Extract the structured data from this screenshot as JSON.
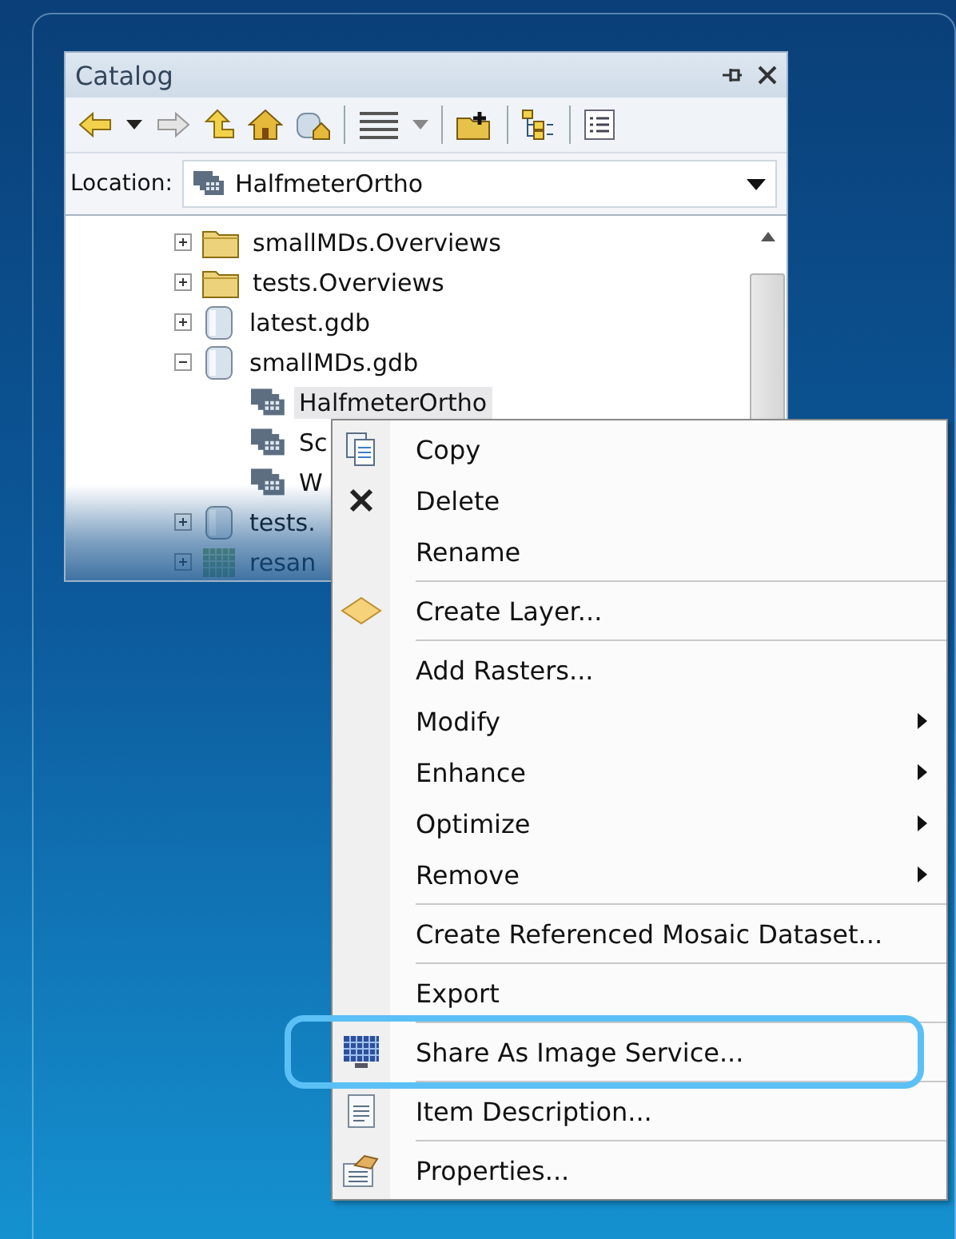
{
  "catalog": {
    "title": "Catalog",
    "location_label": "Location:",
    "location_value": "HalfmeterOrtho",
    "tree": [
      {
        "kind": "folder",
        "label": "smallMDs.Overviews",
        "expanded": false,
        "selected": false
      },
      {
        "kind": "folder",
        "label": "tests.Overviews",
        "expanded": false,
        "selected": false
      },
      {
        "kind": "gdb",
        "label": "latest.gdb",
        "expanded": false,
        "selected": false
      },
      {
        "kind": "gdb",
        "label": "smallMDs.gdb",
        "expanded": true,
        "selected": false,
        "children": [
          {
            "kind": "mosaic",
            "label": "HalfmeterOrtho",
            "selected": true
          },
          {
            "kind": "mosaic",
            "label": "Sc",
            "selected": false
          },
          {
            "kind": "mosaic",
            "label": "W",
            "selected": false
          }
        ]
      },
      {
        "kind": "gdb",
        "label": "tests.",
        "expanded": false,
        "selected": false
      },
      {
        "kind": "raster",
        "label": "resan",
        "expanded": false,
        "selected": false
      }
    ]
  },
  "context_menu": [
    {
      "kind": "copy",
      "label": "Copy",
      "highlighted": false
    },
    {
      "kind": "delete",
      "label": "Delete",
      "highlighted": false
    },
    {
      "kind": "plain",
      "label": "Rename",
      "highlighted": false
    },
    {
      "kind": "separator"
    },
    {
      "kind": "layer",
      "label": "Create Layer...",
      "highlighted": false
    },
    {
      "kind": "separator"
    },
    {
      "kind": "plain",
      "label": "Add Rasters...",
      "highlighted": false
    },
    {
      "kind": "submenu",
      "label": "Modify",
      "highlighted": false
    },
    {
      "kind": "submenu",
      "label": "Enhance",
      "highlighted": false
    },
    {
      "kind": "submenu",
      "label": "Optimize",
      "highlighted": false
    },
    {
      "kind": "submenu",
      "label": "Remove",
      "highlighted": false
    },
    {
      "kind": "separator"
    },
    {
      "kind": "plain",
      "label": "Create Referenced Mosaic Dataset...",
      "highlighted": false
    },
    {
      "kind": "separator"
    },
    {
      "kind": "plain",
      "label": "Export",
      "highlighted": false
    },
    {
      "kind": "separator"
    },
    {
      "kind": "service",
      "label": "Share As Image Service...",
      "highlighted": true
    },
    {
      "kind": "separator"
    },
    {
      "kind": "description",
      "label": "Item Description...",
      "highlighted": false
    },
    {
      "kind": "separator"
    },
    {
      "kind": "properties",
      "label": "Properties...",
      "highlighted": false
    }
  ]
}
